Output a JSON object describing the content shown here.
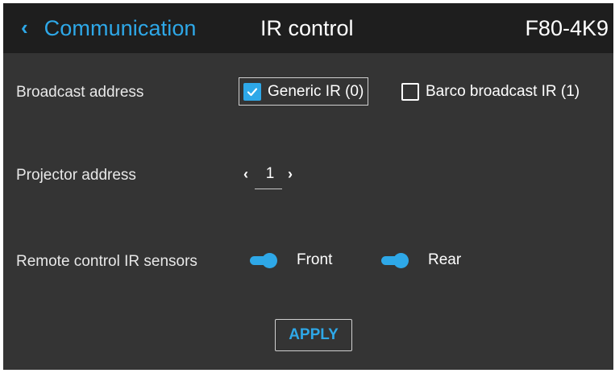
{
  "header": {
    "back_icon": "chevron-left-icon",
    "breadcrumb": "Communication",
    "title": "IR control",
    "device": "F80-4K9"
  },
  "broadcast": {
    "label": "Broadcast address",
    "options": [
      {
        "label": "Generic IR (0)",
        "checked": true
      },
      {
        "label": "Barco broadcast IR (1)",
        "checked": false
      }
    ]
  },
  "projector": {
    "label": "Projector address",
    "value": "1",
    "decrement_icon": "chevron-left-icon",
    "increment_icon": "chevron-right-icon"
  },
  "sensors": {
    "label": "Remote control IR sensors",
    "front": {
      "label": "Front",
      "on": true
    },
    "rear": {
      "label": "Rear",
      "on": true
    }
  },
  "apply_label": "APPLY",
  "colors": {
    "accent": "#2ea8e8",
    "background": "#343434",
    "header": "#1e1e1e"
  }
}
